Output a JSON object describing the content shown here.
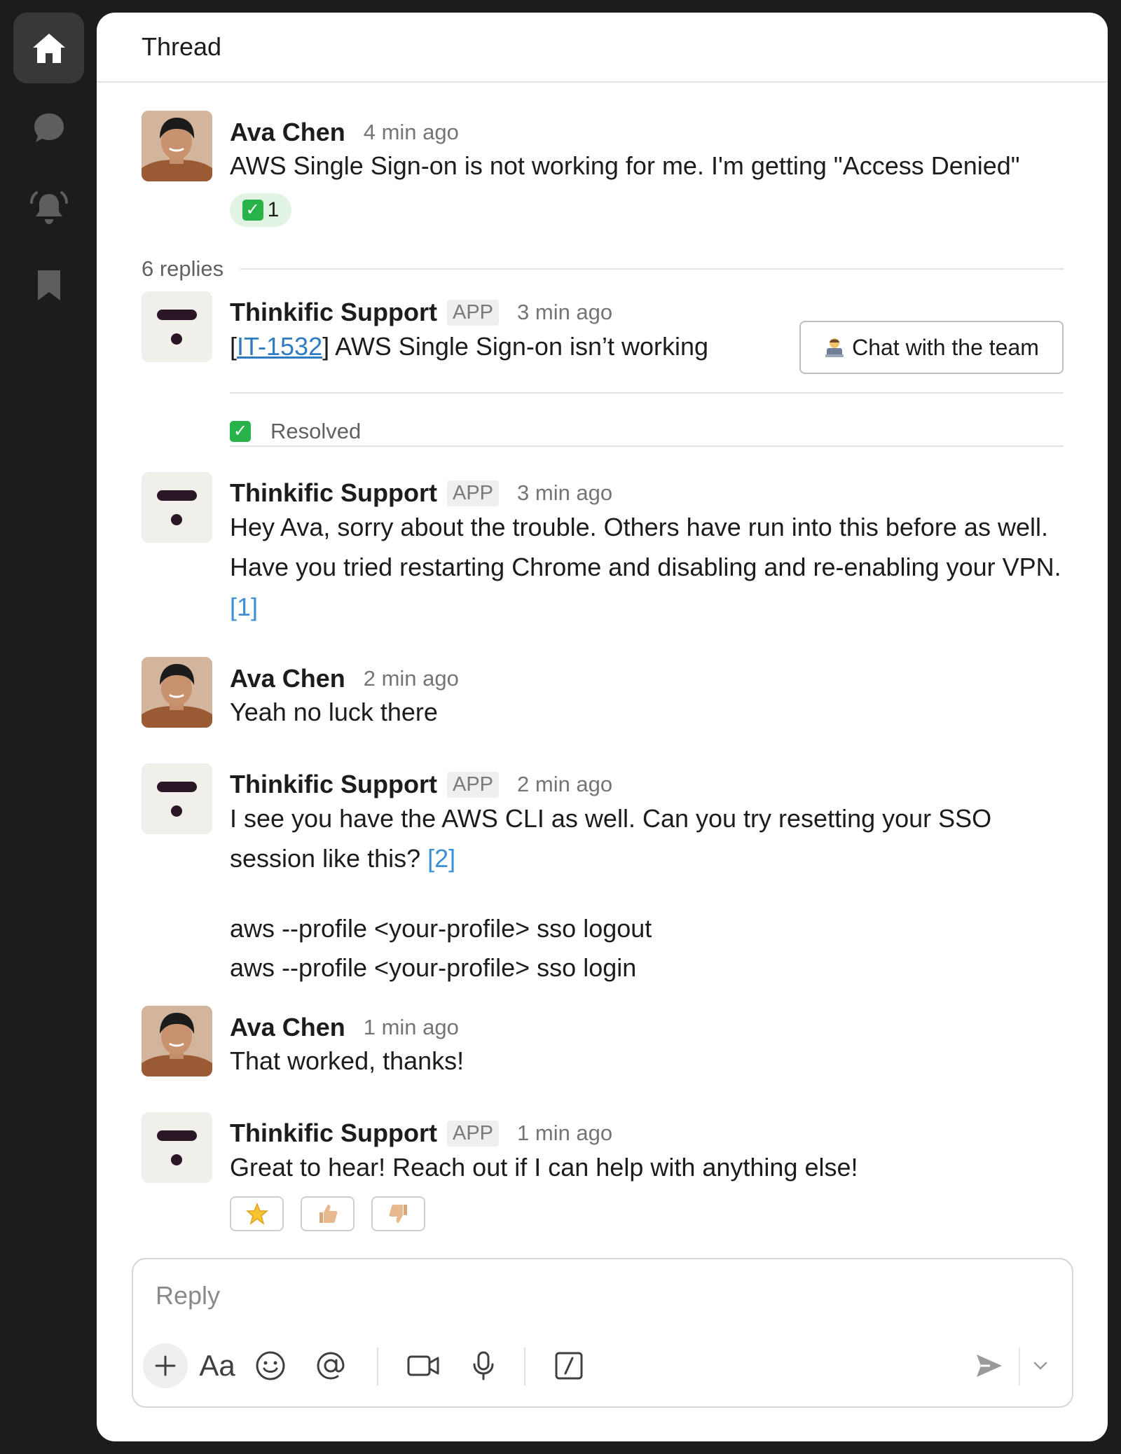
{
  "sidebar": {
    "icons": [
      "home-icon",
      "chat-bubble-icon",
      "bell-icon",
      "bookmark-icon"
    ]
  },
  "thread": {
    "title": "Thread",
    "replies_label": "6 replies"
  },
  "messages": [
    {
      "author": "Ava Chen",
      "time": "4 min ago",
      "text": "AWS Single Sign-on is not working for me. I'm getting \"Access Denied\"",
      "reaction_count": "1"
    },
    {
      "author": "Thinkific Support",
      "badge": "APP",
      "time": "3 min ago",
      "ticket_open": "[",
      "ticket_id": "IT-1532",
      "ticket_close": "]",
      "ticket_title": " AWS Single Sign-on isn’t working",
      "button_label": "Chat with the team",
      "status": "Resolved"
    },
    {
      "author": "Thinkific Support",
      "badge": "APP",
      "time": "3 min ago",
      "text": "Hey Ava, sorry about the trouble. Others have run into this before as well. Have you tried restarting Chrome and disabling and re-enabling your VPN. ",
      "citation": "[1]"
    },
    {
      "author": "Ava Chen",
      "time": "2 min ago",
      "text": "Yeah no luck there"
    },
    {
      "author": "Thinkific Support",
      "badge": "APP",
      "time": "2 min ago",
      "text": "I see you have the AWS CLI as well. Can you try resetting your SSO session like this? ",
      "citation": "[2]",
      "code_line_1": "aws --profile <your-profile> sso logout",
      "code_line_2": "aws --profile <your-profile> sso login"
    },
    {
      "author": "Ava Chen",
      "time": "1 min ago",
      "text": "That worked, thanks!"
    },
    {
      "author": "Thinkific Support",
      "badge": "APP",
      "time": "1 min ago",
      "text": "Great to hear! Reach out if I can help with anything else!",
      "feedback": [
        "star",
        "thumbs-up",
        "thumbs-down"
      ]
    }
  ],
  "composer": {
    "placeholder": "Reply",
    "format_label": "Aa"
  },
  "colors": {
    "sidebar_bg": "#1c1c1c",
    "link": "#2f7bc2",
    "citation": "#3d8fd6",
    "resolved_green": "#27b24a",
    "reaction_bg": "#e1f4e3"
  }
}
